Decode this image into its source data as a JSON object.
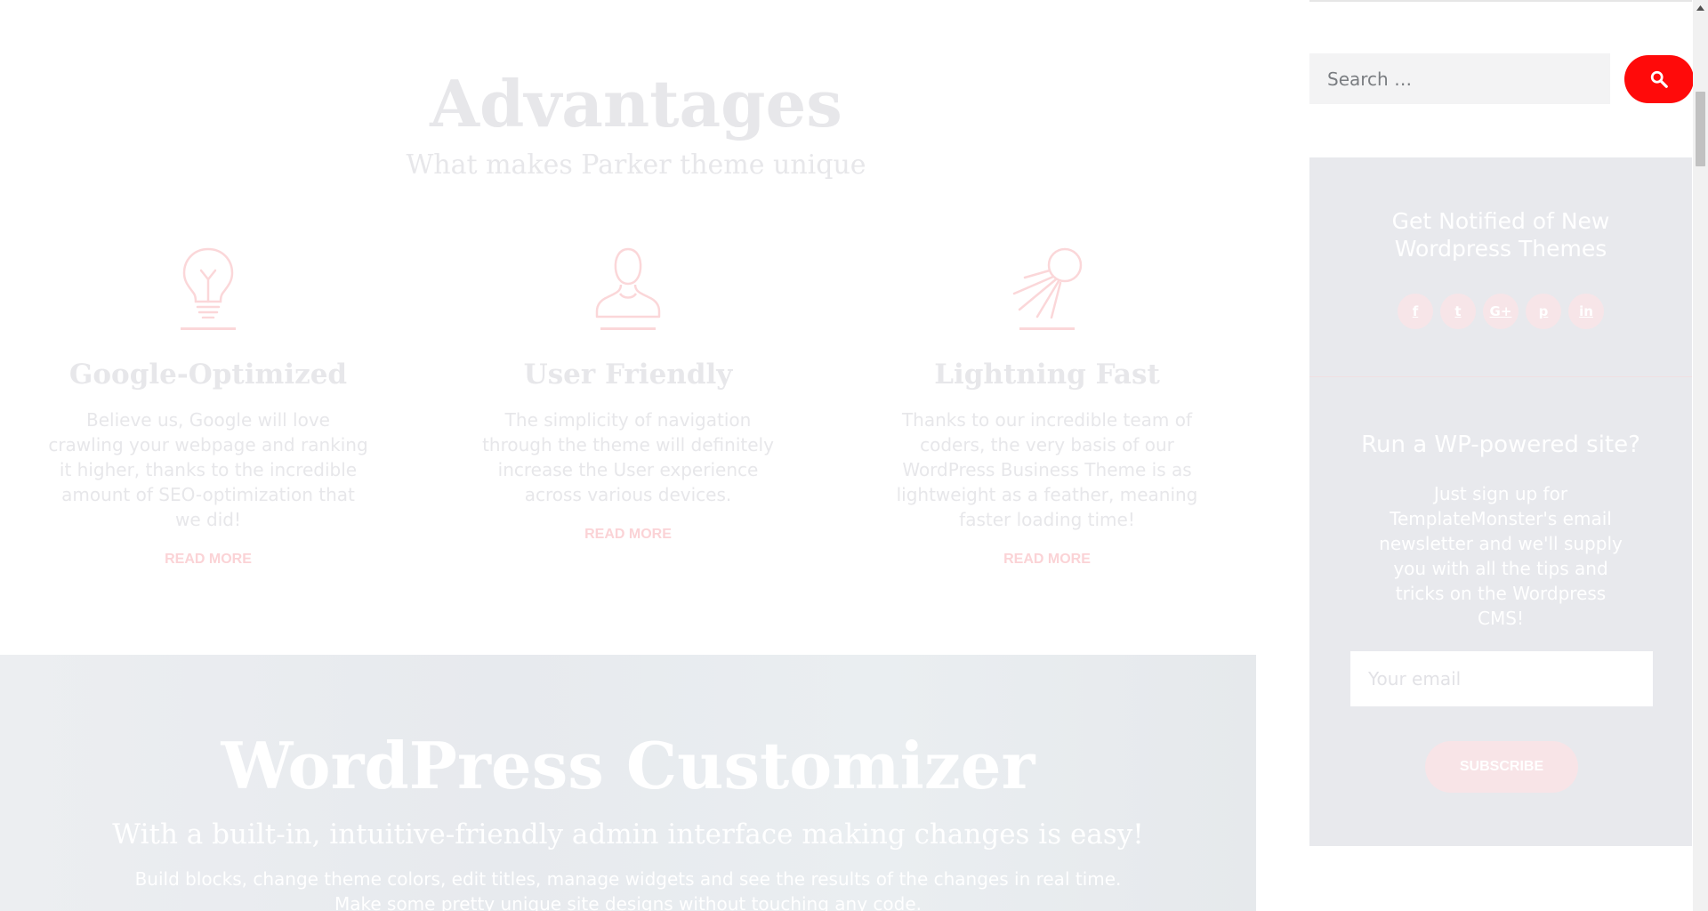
{
  "advantages": {
    "title": "Advantages",
    "subtitle": "What makes Parker theme unique"
  },
  "features": [
    {
      "icon": "lightbulb-icon",
      "title": "Google-Optimized",
      "text": "Believe us, Google will love crawling your webpage and ranking it higher, thanks to the incredible amount of SEO-optimization that we did!",
      "link": "READ MORE"
    },
    {
      "icon": "user-icon",
      "title": "User Friendly",
      "text": "The simplicity of navigation through the theme will definitely increase the User experience across various devices.",
      "link": "READ MORE"
    },
    {
      "icon": "satellite-icon",
      "title": "Lightning Fast",
      "text": "Thanks to our incredible team of coders, the very basis of our WordPress Business Theme is as lightweight as a feather, meaning faster loading time!",
      "link": "READ MORE"
    }
  ],
  "customizer": {
    "title": "WordPress Customizer",
    "subtitle": "With a built-in, intuitive-friendly admin interface making changes is easy!",
    "text_line1": "Build blocks, change theme colors, edit titles, manage widgets and see the results of the changes in real time.",
    "text_line2": "Make some pretty unique site designs without touching any code."
  },
  "sidebar": {
    "search": {
      "placeholder": "Search …",
      "button_icon": "search-icon"
    },
    "notify": {
      "title": "Get Notified of New Wordpress Themes",
      "social": [
        {
          "icon": "facebook-icon",
          "glyph": "f"
        },
        {
          "icon": "twitter-icon",
          "glyph": "t"
        },
        {
          "icon": "google-plus-icon",
          "glyph": "G+"
        },
        {
          "icon": "pinterest-icon",
          "glyph": "p"
        },
        {
          "icon": "linkedin-icon",
          "glyph": "in"
        }
      ]
    },
    "newsletter": {
      "title": "Run a WP-powered site?",
      "text": "Just sign up for TemplateMonster's email newsletter and we'll supply you with all the tips and tricks on the Wordpress CMS!",
      "email_placeholder": "Your email",
      "button_label": "SUBSCRIBE"
    }
  },
  "colors": {
    "accent": "#ff0a0a",
    "faded_accent": "#fbd3d6",
    "widget_bg": "#e8e9ed"
  }
}
